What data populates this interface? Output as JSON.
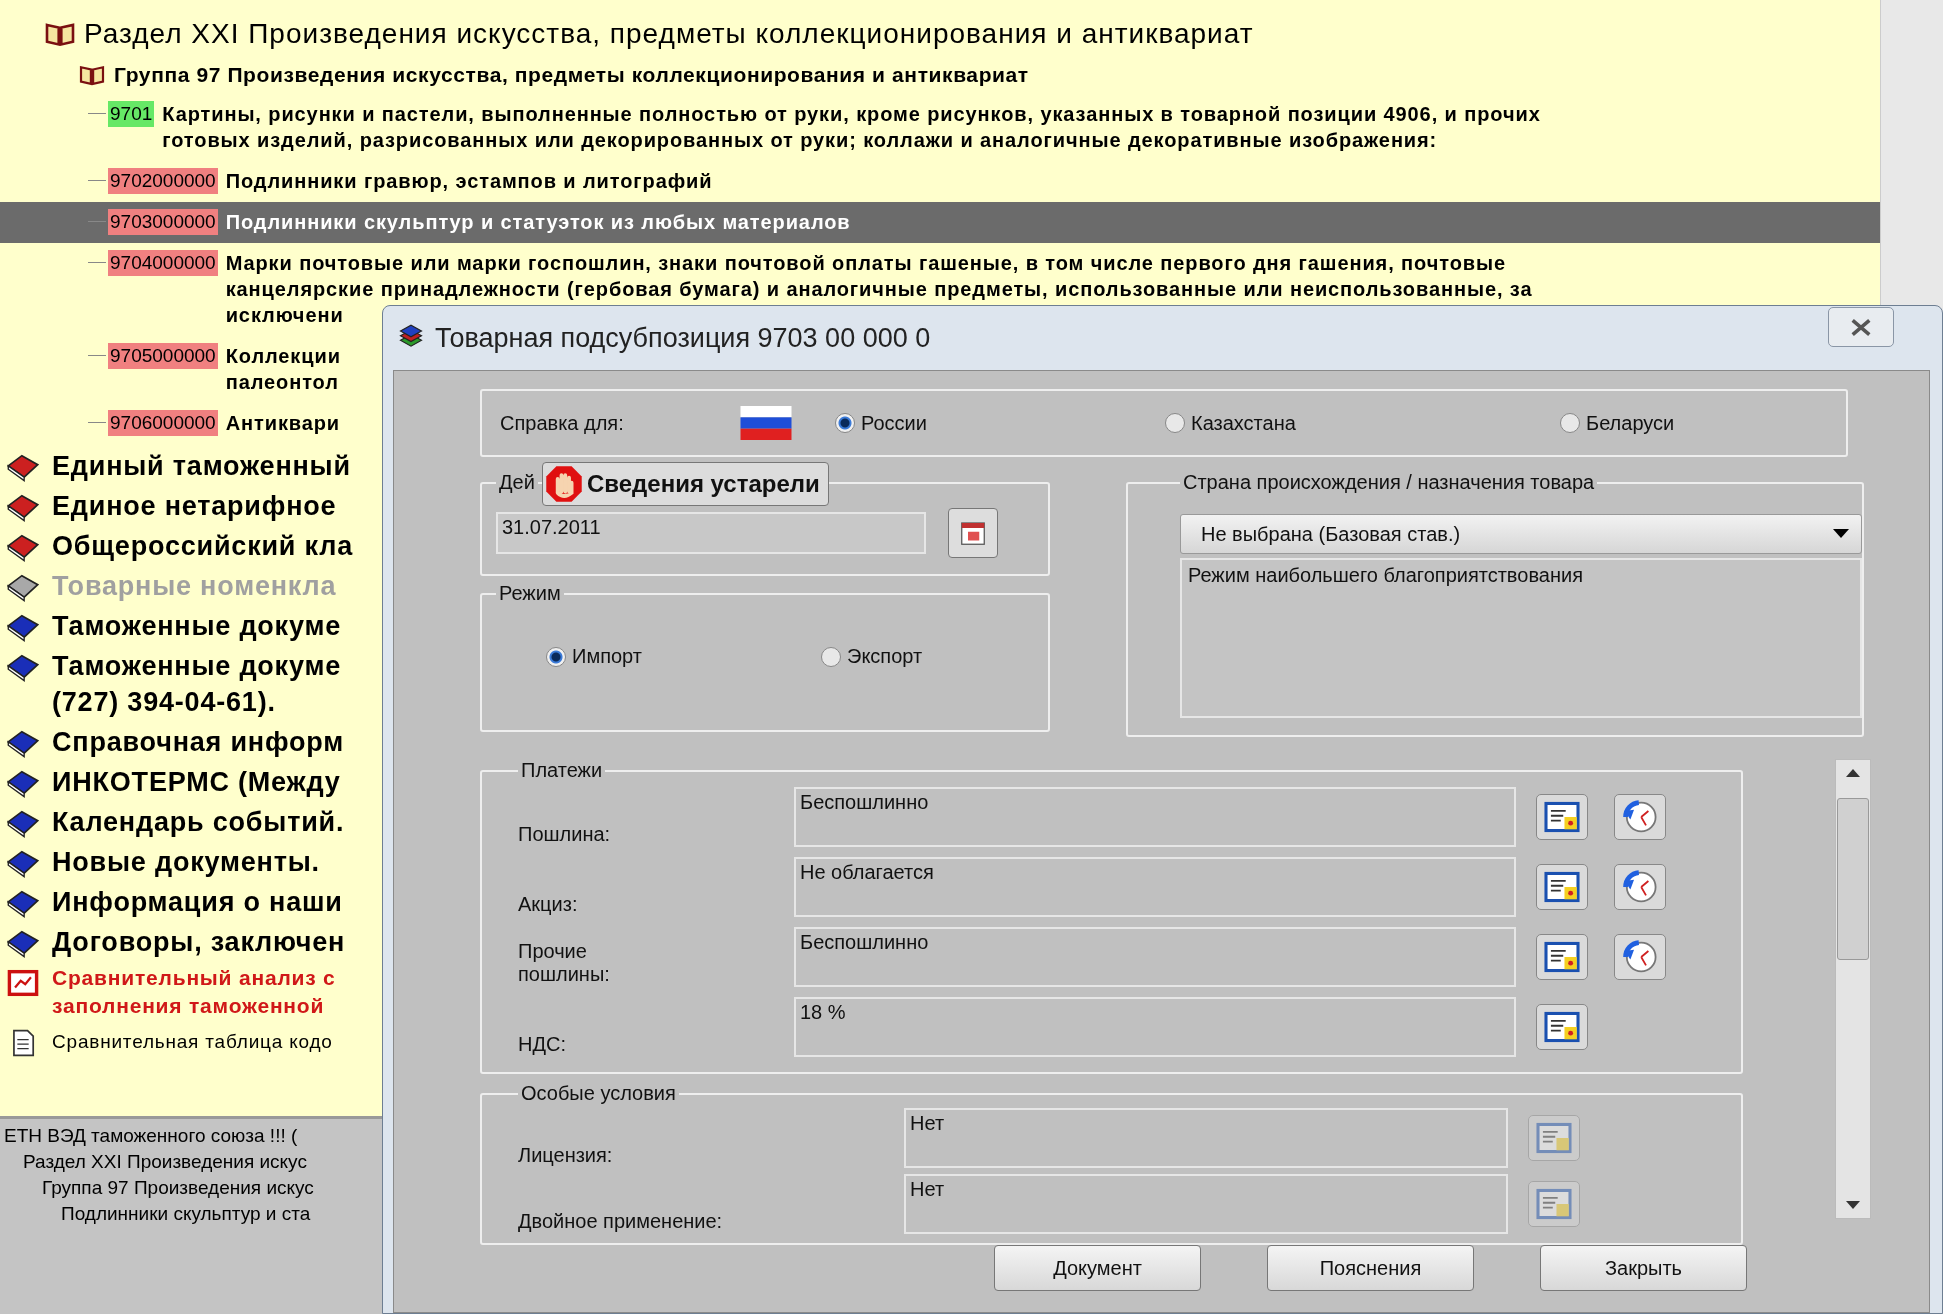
{
  "tree": [
    {
      "kind": "section",
      "label": "Раздел XXI Произведения искусства, предметы коллекционирования и антиквариат",
      "children": [
        {
          "kind": "group",
          "label": "Группа 97 Произведения искусства, предметы коллекционирования и антиквариат",
          "children": [
            {
              "code": "9701",
              "color": "#66e866",
              "selected": false,
              "lines": [
                "Картины, рисунки и пастели, выполненные полностью от руки, кроме рисунков, указанных в товарной позиции 4906, и прочих",
                "готовых изделий, разрисованных или декорированных от руки; коллажи и аналогичные декоративные изображения:"
              ]
            },
            {
              "code": "9702000000",
              "color": "#f08080",
              "selected": false,
              "lines": [
                "Подлинники гравюр, эстампов и литографий"
              ]
            },
            {
              "code": "9703000000",
              "color": "#f08080",
              "selected": true,
              "lines": [
                "Подлинники скульптур и статуэток из любых материалов"
              ]
            },
            {
              "code": "9704000000",
              "color": "#f08080",
              "selected": false,
              "lines": [
                "Марки почтовые или марки госпошлин, знаки почтовой оплаты гашеные, в том числе первого дня гашения, почтовые",
                "канцелярские принадлежности (гербовая бумага) и аналогичные предметы, использованные или неиспользованные, за",
                "исключени"
              ]
            },
            {
              "code": "9705000000",
              "color": "#f08080",
              "selected": false,
              "lines": [
                "Коллекции",
                "палеонтол"
              ]
            },
            {
              "code": "9706000000",
              "color": "#f08080",
              "selected": false,
              "lines": [
                "Антиквари"
              ]
            }
          ]
        }
      ]
    },
    {
      "kind": "book",
      "color": "#cc2020",
      "disabled": false,
      "lines": [
        "Единый таможенный"
      ]
    },
    {
      "kind": "book",
      "color": "#cc2020",
      "disabled": false,
      "lines": [
        "Единое нетарифное"
      ]
    },
    {
      "kind": "book",
      "color": "#cc2020",
      "disabled": false,
      "lines": [
        "Общероссийский кла"
      ]
    },
    {
      "kind": "book",
      "color": "#a8a8a8",
      "disabled": true,
      "lines": [
        "Товарные номенкла"
      ]
    },
    {
      "kind": "book",
      "color": "#1a2eb8",
      "disabled": false,
      "lines": [
        "Таможенные докуме"
      ]
    },
    {
      "kind": "book",
      "color": "#1a2eb8",
      "disabled": false,
      "lines": [
        "Таможенные докуме",
        "(727) 394-04-61)."
      ]
    },
    {
      "kind": "book",
      "color": "#1a2eb8",
      "disabled": false,
      "lines": [
        "Справочная информ"
      ]
    },
    {
      "kind": "book",
      "color": "#1a2eb8",
      "disabled": false,
      "lines": [
        "ИНКОТЕРМС (Между"
      ]
    },
    {
      "kind": "book",
      "color": "#1a2eb8",
      "disabled": false,
      "lines": [
        "Календарь событий."
      ]
    },
    {
      "kind": "book",
      "color": "#1a2eb8",
      "disabled": false,
      "lines": [
        "Новые документы."
      ]
    },
    {
      "kind": "book",
      "color": "#1a2eb8",
      "disabled": false,
      "lines": [
        "Информация о наши"
      ]
    },
    {
      "kind": "book",
      "color": "#1a2eb8",
      "disabled": false,
      "lines": [
        "Договоры, заключен"
      ]
    },
    {
      "kind": "analysis",
      "lines": [
        "Сравнительный анализ с",
        "заполнения таможенной"
      ]
    },
    {
      "kind": "doc",
      "lines": [
        "Сравнительная таблица кодо"
      ]
    }
  ],
  "path": [
    "ЕТН ВЭД таможенного союза !!! (",
    "Раздел XXI Произведения искус",
    "Группа 97 Произведения искус",
    "Подлинники скульптур и ста"
  ],
  "dialog": {
    "title": "Товарная подсубпозиция 9703 00 000 0",
    "reference": {
      "label": "Справка для:",
      "options": [
        {
          "label": "России",
          "selected": true
        },
        {
          "label": "Казахстана",
          "selected": false
        },
        {
          "label": "Беларуси",
          "selected": false
        }
      ]
    },
    "validity": {
      "legend": "Дей",
      "warning": "Сведения устарели",
      "date": "31.07.2011"
    },
    "mode": {
      "legend": "Режим",
      "options": [
        {
          "label": "Импорт",
          "selected": true
        },
        {
          "label": "Экспорт",
          "selected": false
        }
      ]
    },
    "country": {
      "legend": "Страна происхождения / назначения товара",
      "value": "Не выбрана (Базовая став.)",
      "regime": "Режим наибольшего благоприятствования"
    },
    "payments": {
      "legend": "Платежи",
      "rows": [
        {
          "label": "Пошлина:",
          "value": "Беспошлинно",
          "history": true
        },
        {
          "label": "Акциз:",
          "value": "Не облагается",
          "history": true
        },
        {
          "label": "Прочие пошлины:",
          "value": "Беспошлинно",
          "history": true
        },
        {
          "label": "НДС:",
          "value": "18 %",
          "history": false
        }
      ]
    },
    "conditions": {
      "legend": "Особые условия",
      "rows": [
        {
          "label": "Лицензия:",
          "value": "Нет",
          "disabled": true
        },
        {
          "label": "Двойное применение:",
          "value": "Нет",
          "disabled": true
        }
      ]
    },
    "buttons": [
      "Документ",
      "Пояснения",
      "Закрыть"
    ]
  }
}
